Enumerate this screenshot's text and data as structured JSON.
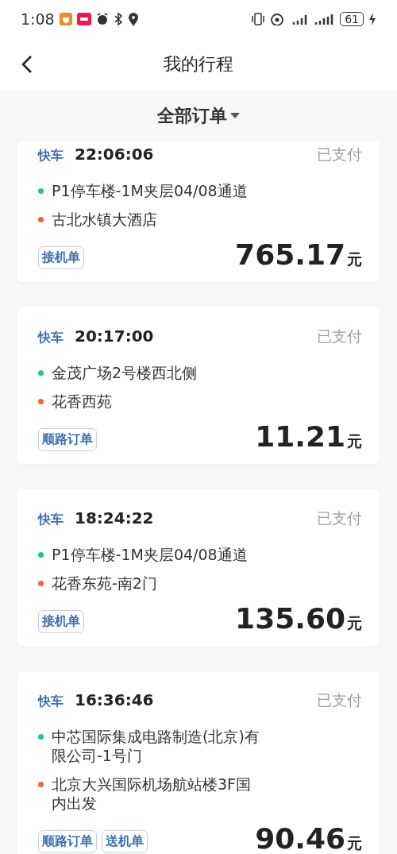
{
  "status_bar": {
    "time": "1:08",
    "battery": "61"
  },
  "header": {
    "title": "我的行程"
  },
  "filter": {
    "label": "全部订单"
  },
  "orders": [
    {
      "type": "快车",
      "time": "22:06:06",
      "status": "已支付",
      "from": "P1停车楼-1M夹层04/08通道",
      "to": "古北水镇大酒店",
      "tags": [
        "接机单"
      ],
      "price": "765.17",
      "unit": "元"
    },
    {
      "type": "快车",
      "time": "20:17:00",
      "status": "已支付",
      "from": "金茂广场2号楼西北侧",
      "to": "花香西苑",
      "tags": [
        "顺路订单"
      ],
      "price": "11.21",
      "unit": "元"
    },
    {
      "type": "快车",
      "time": "18:24:22",
      "status": "已支付",
      "from": "P1停车楼-1M夹层04/08通道",
      "to": "花香东苑-南2门",
      "tags": [
        "接机单"
      ],
      "price": "135.60",
      "unit": "元"
    },
    {
      "type": "快车",
      "time": "16:36:46",
      "status": "已支付",
      "from": "中芯国际集成电路制造(北京)有限公司-1号门",
      "to": "北京大兴国际机场航站楼3F国内出发",
      "tags": [
        "顺路订单",
        "送机单"
      ],
      "price": "90.46",
      "unit": "元"
    }
  ]
}
